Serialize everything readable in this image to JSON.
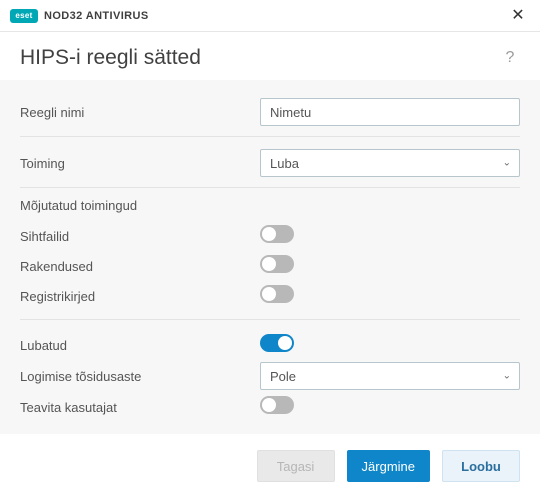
{
  "brand": {
    "logo_text": "eset",
    "product": "NOD32 ANTIVIRUS"
  },
  "header": {
    "title": "HIPS-i reegli sätted"
  },
  "form": {
    "rule_name": {
      "label": "Reegli nimi",
      "value": "Nimetu"
    },
    "action": {
      "label": "Toiming",
      "value": "Luba"
    },
    "affected_title": "Mõjutatud toimingud",
    "target_files": {
      "label": "Sihtfailid"
    },
    "applications": {
      "label": "Rakendused"
    },
    "registry": {
      "label": "Registrikirjed"
    },
    "enabled": {
      "label": "Lubatud"
    },
    "severity": {
      "label": "Logimise tõsidusaste",
      "value": "Pole"
    },
    "notify": {
      "label": "Teavita kasutajat"
    }
  },
  "footer": {
    "back": "Tagasi",
    "next": "Järgmine",
    "cancel": "Loobu"
  }
}
